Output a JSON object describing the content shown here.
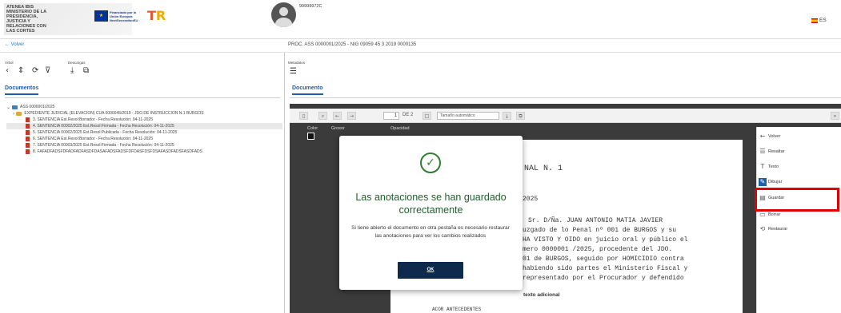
{
  "header": {
    "org_name": "ATENEA IBIS",
    "ministry": "MINISTERIO DE LA PRESIDENCIA, JUSTICIA Y RELACIONES CON LAS CORTES",
    "eu_funding": "Financiado por la Unión Europea NextGenerationEU",
    "user_id": "99999972C",
    "language": "ES"
  },
  "nav": {
    "back_label": "← Volver",
    "proc_title": "PROC. ASS 0000001/2025 - NIG 09059 45 3 2019 0000135"
  },
  "left_toolbar": {
    "arbol_label": "Árbol",
    "descargas_label": "Descargas"
  },
  "right_toolbar": {
    "metadatos_label": "Metadatos"
  },
  "tabs": {
    "documentos": "Documentos",
    "documento": "Documento"
  },
  "tree": {
    "root": "ASS 0000001/2025",
    "folder": "EXPEDIENTE JUDICIAL (ELEVACION) CUA 0000045/2019 - JDO.DE INSTRUCCION N.1 BURGOS",
    "items": [
      "3. SENTENCIA Est.Resol:Borrador - Fecha Resolución: 04-11-2025",
      "4. SENTENCIA 00002/2025 Est.Resol:Firmada - Fecha Resolución: 04-11-2025",
      "5. SENTENCIA 00002/2025 Est.Resol:Publicada - Fecha Resolución: 04-11-2025",
      "6. SENTENCIA Est.Resol:Borrador - Fecha Resolución: 04-11-2025",
      "7. SENTENCIA 00003/2025 Est.Resol:Firmada - Fecha Resolución: 04-11-2025",
      "8. FAFADFADSFDFADFADFASDFDASAFADSFADSFDFDASFDSFDSAFASDFADSFASDFADS"
    ],
    "selected_index": 1
  },
  "viewer": {
    "page_number": "1",
    "page_total": "DE 2",
    "zoom": "Tamaño automático",
    "annot_color_label": "Color",
    "annot_grosor_label": "Grosor",
    "annot_opacidad_label": "Opacidad"
  },
  "document_text": {
    "line1": "NAL N. 1",
    "line2": "2025",
    "line3": "Sr. D/Ña.    JUAN  ANTONIO  MATIA  JAVIER",
    "line4": "uzgado  de  lo  Penal  nº  001  de  BURGOS  y  su",
    "line5": "HA  VISTO  Y  OIDO  en  juicio  oral  y  público  el",
    "line6": "mero   0000001   /2025,   procedente   del   JDO.",
    "line7": "01   de  BURGOS,   seguido  por  HOMICIDIO  contra",
    "line8": "habiendo  sido  partes  el  Ministerio  Fiscal  y",
    "line9": "representado  por  el  Procurador     y  defendido",
    "extra_title": "texto adicional",
    "extra_line": "ACOR ANTECEDENTES"
  },
  "annotations_panel": {
    "volver": "Volver",
    "resaltar": "Resaltar",
    "texto": "Texto",
    "dibujar": "Dibujar",
    "guardar": "Guardar",
    "borrar": "Borrar",
    "restaurar": "Restaurar"
  },
  "modal": {
    "title": "Las anotaciones se han guardado correctamente",
    "message": "Si tiene abierto el documento en otra pestaña es necesario restaurar las anotaciones para ver los cambios realizados",
    "ok_label": "OK"
  },
  "colors": {
    "brand_blue": "#1e5fa8",
    "success_green": "#1f5f2a",
    "button_navy": "#0d2a4c",
    "highlight_red": "#e00000"
  }
}
